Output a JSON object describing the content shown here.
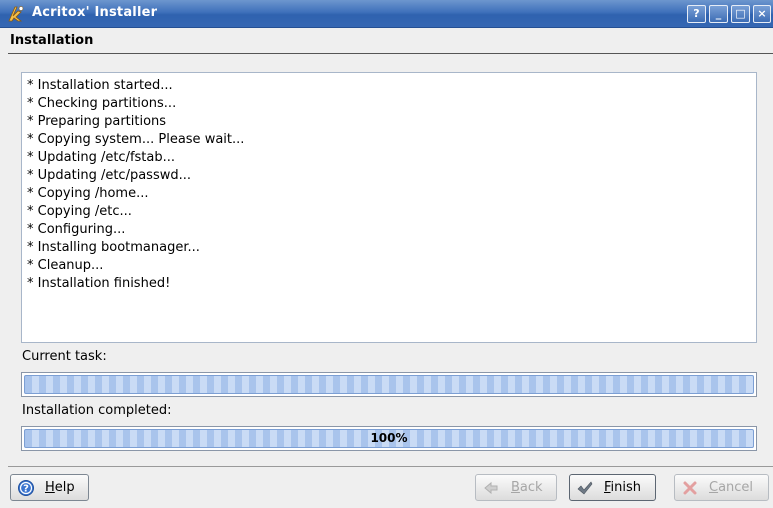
{
  "window": {
    "title": "Acritox' Installer",
    "controls": [
      "?",
      "_",
      "□",
      "×"
    ]
  },
  "header": {
    "title": "Installation"
  },
  "log": {
    "lines": [
      "* Installation started...",
      "* Checking partitions...",
      "* Preparing partitions",
      "* Copying system... Please wait...",
      "* Updating /etc/fstab...",
      "* Updating /etc/passwd...",
      "* Copying /home...",
      "* Copying /etc...",
      "* Configuring...",
      "* Installing bootmanager...",
      "* Cleanup...",
      "* Installation finished!"
    ]
  },
  "progress": {
    "current_task_label": "Current task:",
    "current_task_fraction": 1.0,
    "completed_label": "Installation completed:",
    "completed_fraction": 1.0,
    "completed_text": "100%"
  },
  "buttons": {
    "help": {
      "label_first": "H",
      "label_rest": "elp",
      "icon": "help-icon"
    },
    "back": {
      "label_first": "B",
      "label_rest": "ack",
      "icon": "arrow-left-icon"
    },
    "finish": {
      "label_first": "F",
      "label_rest": "inish",
      "icon": "checkmark-icon"
    },
    "cancel": {
      "label_first": "C",
      "label_rest": "ancel",
      "icon": "cross-icon"
    }
  },
  "colors": {
    "titlebar": "#3f71bb",
    "progress_fill": "#a9c4ec"
  }
}
